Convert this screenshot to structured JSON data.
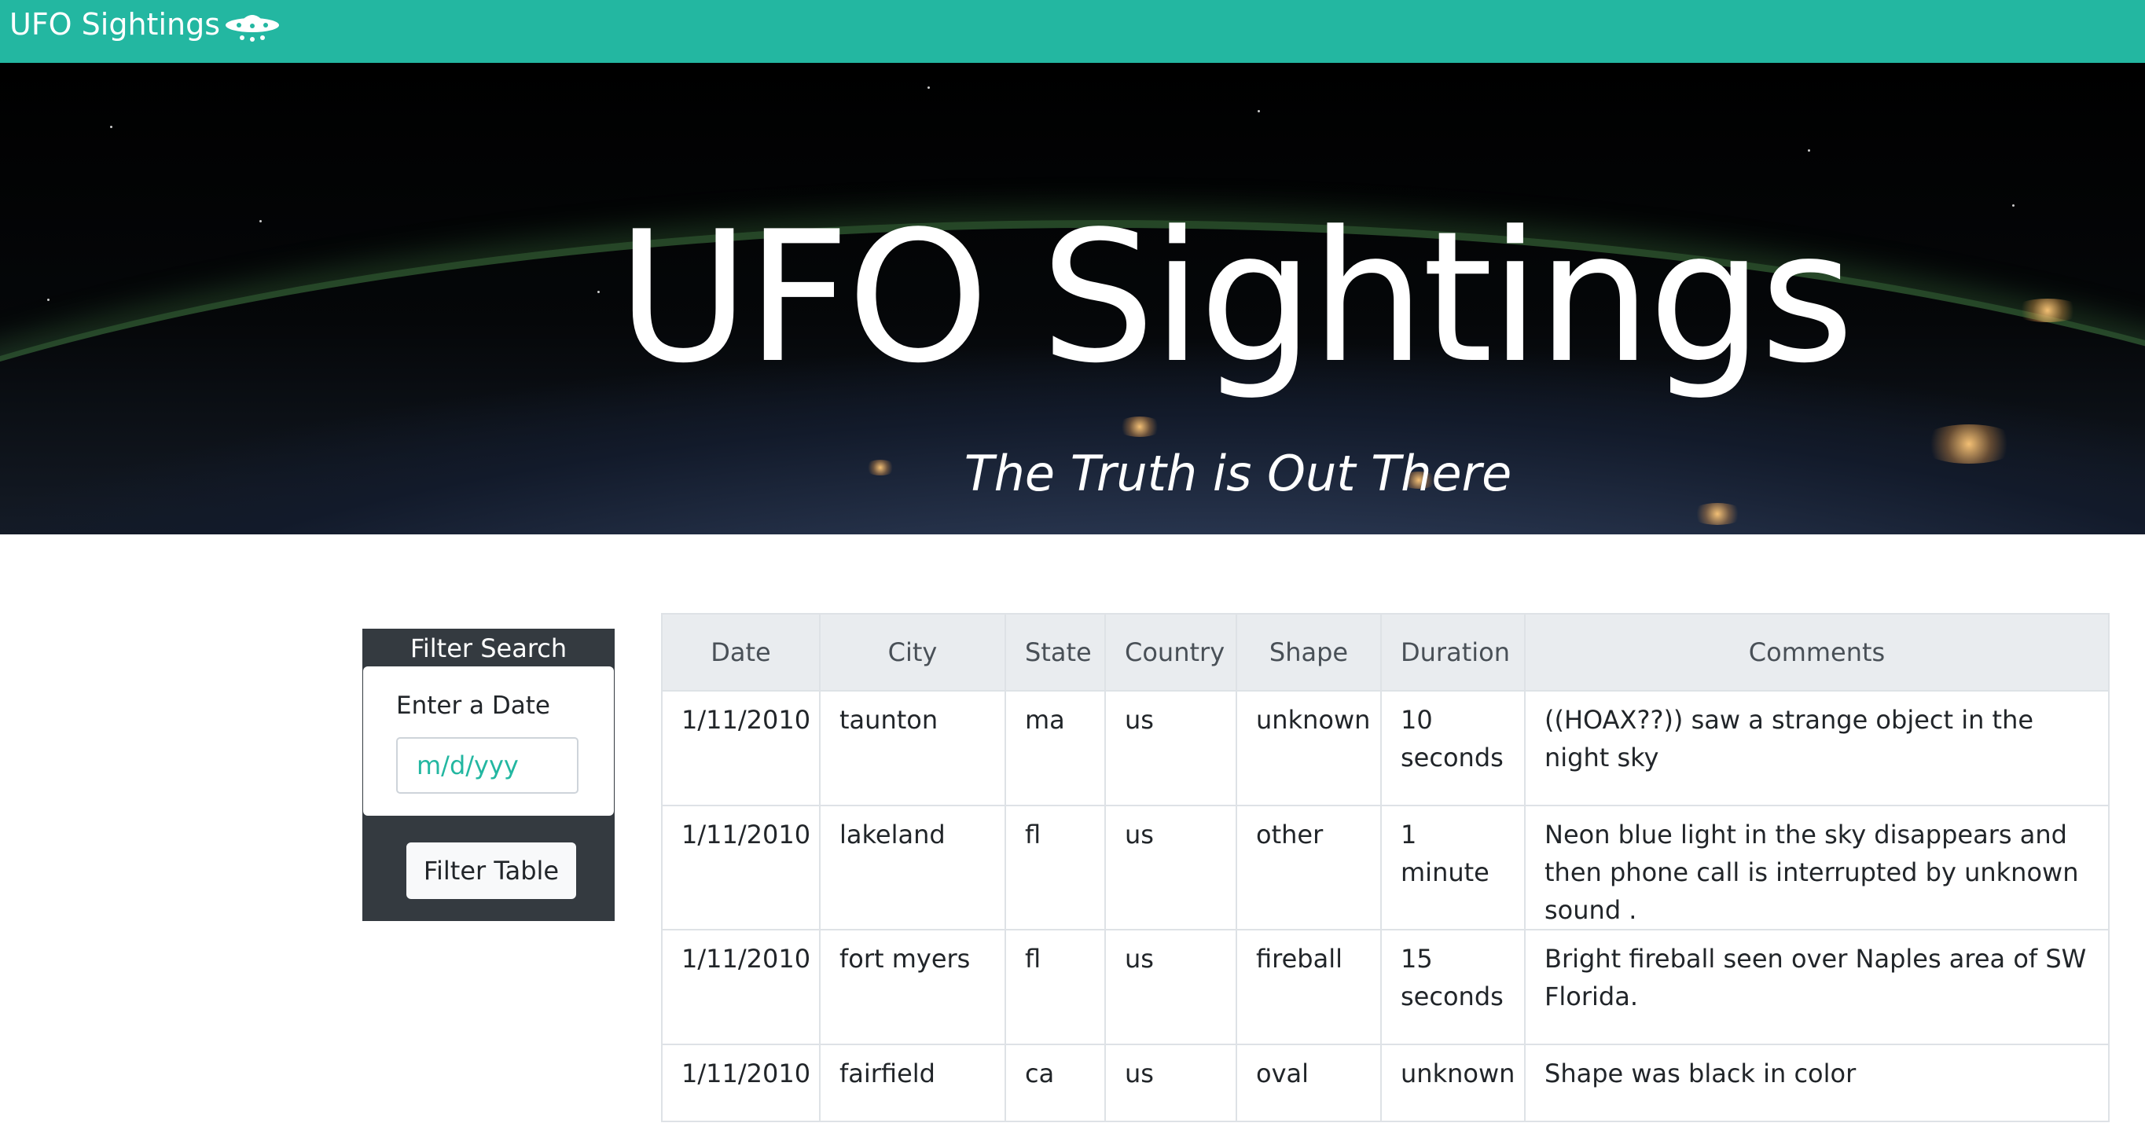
{
  "navbar": {
    "brand_text": "UFO Sightings",
    "brand_icon": "ufo-icon",
    "background": "#23b7a1"
  },
  "hero": {
    "title": "UFO Sightings",
    "subtitle": "The Truth is Out There"
  },
  "filter": {
    "header": "Filter Search",
    "label": "Enter a Date",
    "placeholder": "m/d/yyy",
    "button_label": "Filter Table"
  },
  "table": {
    "headers": [
      "Date",
      "City",
      "State",
      "Country",
      "Shape",
      "Duration",
      "Comments"
    ],
    "rows": [
      {
        "date": "1/11/2010",
        "city": "taunton",
        "state": "ma",
        "country": "us",
        "shape": "unknown",
        "duration": "10 seconds",
        "comments": "((HOAX??)) saw a strange object in the night sky"
      },
      {
        "date": "1/11/2010",
        "city": "lakeland",
        "state": "fl",
        "country": "us",
        "shape": "other",
        "duration": "1 minute",
        "comments": "Neon blue light in the sky disappears and then phone call is interrupted by unknown sound ."
      },
      {
        "date": "1/11/2010",
        "city": "fort myers",
        "state": "fl",
        "country": "us",
        "shape": "fireball",
        "duration": "15 seconds",
        "comments": "Bright fireball seen over Naples area of SW Florida."
      },
      {
        "date": "1/11/2010",
        "city": "fairfield",
        "state": "ca",
        "country": "us",
        "shape": "oval",
        "duration": "unknown",
        "comments": "Shape was black in color"
      }
    ]
  },
  "colors": {
    "accent": "#23b7a1",
    "panel": "#343a40",
    "table_header": "#e9ecef"
  }
}
